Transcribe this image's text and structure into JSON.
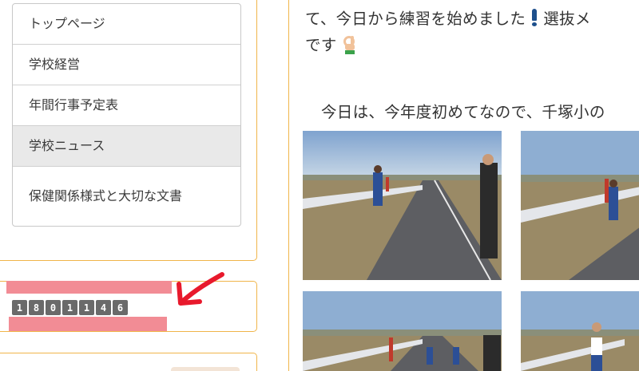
{
  "sidebar": {
    "menu": [
      {
        "label": "トップページ"
      },
      {
        "label": "学校経営"
      },
      {
        "label": "年間行事予定表"
      },
      {
        "label": "学校ニュース"
      },
      {
        "label": "保健関係様式と大切な文書"
      }
    ],
    "active_index": 3,
    "counter_digits": [
      "1",
      "8",
      "0",
      "1",
      "1",
      "4",
      "6"
    ]
  },
  "article": {
    "line1": "て、今日から練習を始めました",
    "line1_after": "選抜メ",
    "line2": "です",
    "line3": "今日は、今年度初めてなので、千塚小の"
  },
  "colors": {
    "panel_border": "#f0b54a",
    "redaction_pink": "#f28c95",
    "arrow_red": "#e8192c",
    "active_menu_bg": "#e9e9e9"
  },
  "icons": {
    "exclamation": "exclamation-emoji-icon",
    "ok_hand": "ok-hand-emoji-icon",
    "arrow": "red-arrow-annotation"
  }
}
